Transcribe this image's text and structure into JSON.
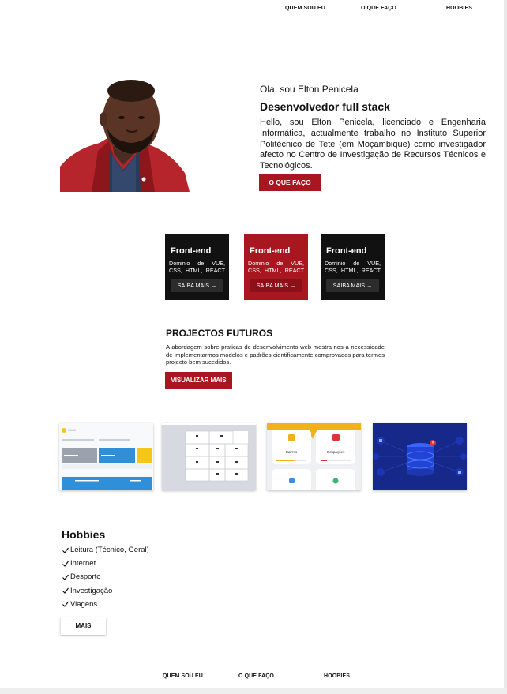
{
  "nav": {
    "about": "QUEM SOU EU",
    "what_i_do": "O QUE FAÇO",
    "hobbies": "HOOBIES"
  },
  "hero": {
    "greeting": "Ola, sou Elton Penicela",
    "title": "Desenvolvedor full stack",
    "description": "Hello, sou Elton Penicela, licenciado e Engenharia Informática, actualmente trabalho no Instituto Superior Politécnico de Tete (em Moçambique) como investigador afecto no Centro de Investigação de Recursos Técnicos e Tecnológicos.",
    "button": "O QUE FAÇO"
  },
  "cards": [
    {
      "title": "Front-end",
      "text": "Dominio de VUE, CSS, HTML, REACT",
      "button": "SAIBA MAIS →",
      "style": "dark"
    },
    {
      "title": "Front-end",
      "text": "Dominio de VUE, CSS, HTML, REACT",
      "button": "SAIBA MAIS →",
      "style": "red"
    },
    {
      "title": "Front-end",
      "text": "Dominio de VUE, CSS, HTML, REACT",
      "button": "SAIBA MAIS →",
      "style": "dark"
    }
  ],
  "projects": {
    "title": "PROJECTOS FUTUROS",
    "description": "A abordagem sobre praticas de desenvolvimento web mostra-nos a necessidade de implementarmos modelos e padrões cientificamente comprovados para termos projecto bem sucedidos.",
    "button": "VISUALIZAR MAIS",
    "thumbnails": [
      {
        "name": "dashboard-thumbnail"
      },
      {
        "name": "grid-layout-thumbnail"
      },
      {
        "name": "mobile-app-thumbnail",
        "labels": [
          "Bairros",
          "Ocupações"
        ]
      },
      {
        "name": "database-thumbnail"
      }
    ]
  },
  "hobbies": {
    "title": "Hobbies",
    "items": [
      "Leitura (Técnico, Geral)",
      "Internet",
      "Desporto",
      "Investigação",
      "Viagens"
    ],
    "button": "MAIS"
  },
  "footer_nav": {
    "about": "QUEM SOU EU",
    "what_i_do": "O QUE FAÇO",
    "hobbies": "HOOBIES"
  },
  "colors": {
    "accent_red": "#a8161f",
    "card_dark": "#111111",
    "database_blue": "#16288a"
  }
}
